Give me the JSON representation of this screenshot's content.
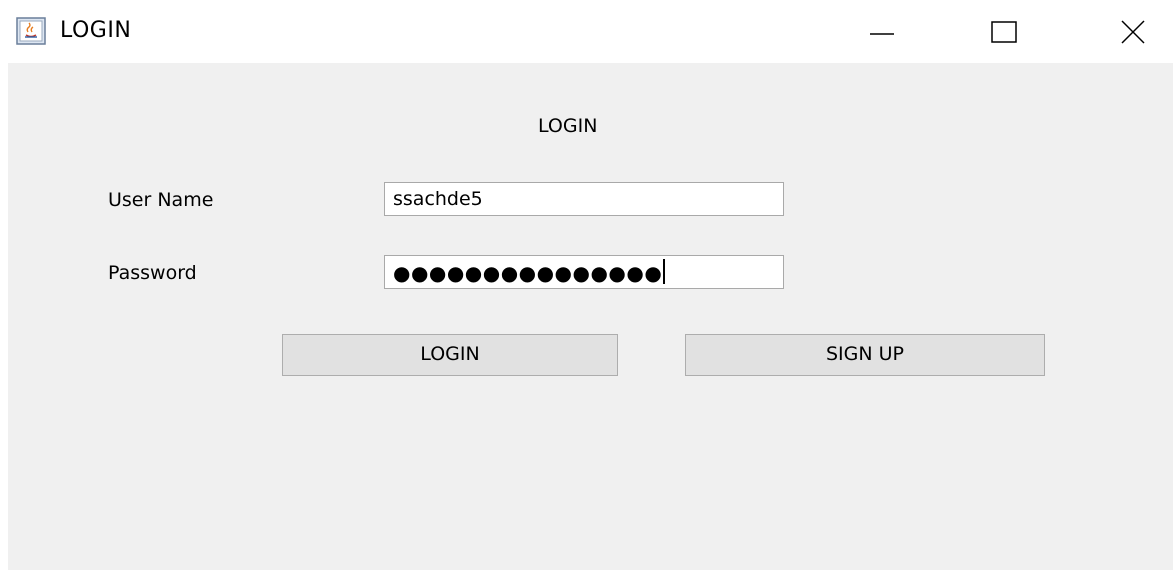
{
  "window": {
    "title": "LOGIN",
    "app_icon": "java-cup-icon",
    "controls": {
      "minimize_icon": "minimize-icon",
      "maximize_icon": "maximize-icon",
      "close_icon": "close-icon"
    }
  },
  "form": {
    "heading": "LOGIN",
    "username_label": "User Name",
    "username_value": "ssachde5",
    "password_label": "Password",
    "password_masked": "●●●●●●●●●●●●●●●",
    "login_button": "LOGIN",
    "signup_button": "SIGN UP"
  },
  "colors": {
    "content_bg": "#f0f0f0",
    "button_bg": "#e1e1e1",
    "field_border": "#a9a9a9"
  }
}
